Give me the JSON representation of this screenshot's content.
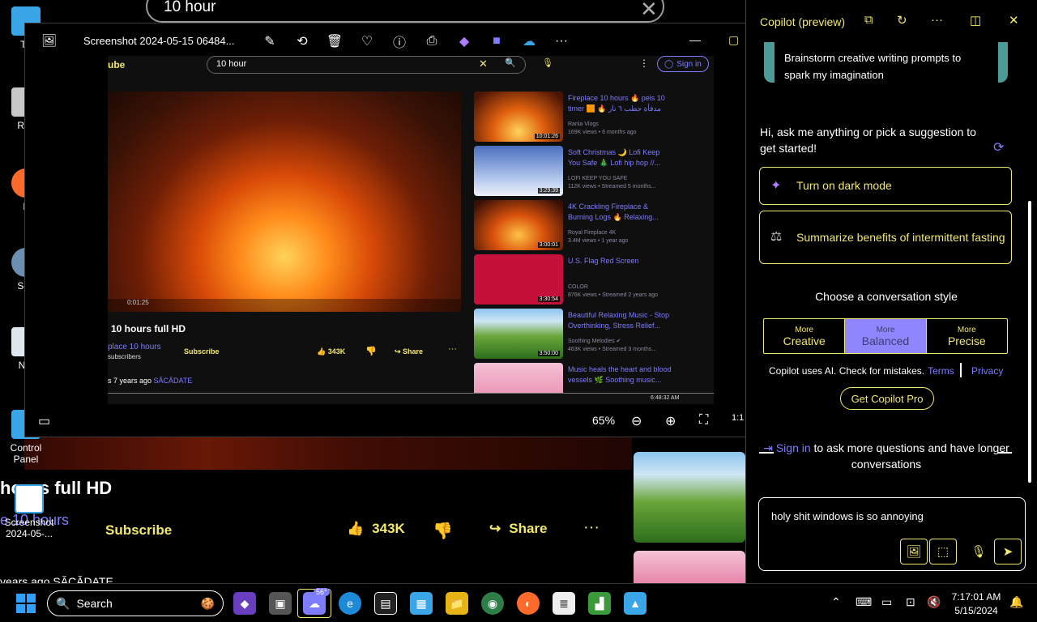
{
  "background": {
    "search_text": "10 hour",
    "video_title": "hours full HD",
    "channel": "e 10 hours",
    "subscribe": "Subscribe",
    "likes": "343K",
    "share": "Share",
    "date": "years ago SĂCĂDATE"
  },
  "desktop": {
    "icons": [
      {
        "label": "Th"
      },
      {
        "label": "Rec"
      },
      {
        "label": "F"
      },
      {
        "label": "Sup"
      },
      {
        "label": "Not"
      },
      {
        "label": "Control Panel"
      },
      {
        "label": "Screenshot 2024-05-..."
      }
    ]
  },
  "viewer": {
    "title": "Screenshot 2024-05-15 06484...",
    "zoom": "65%",
    "shot": {
      "logo": "ube",
      "search_text": "10 hour",
      "signin": "Sign in",
      "video_title": "10 hours full HD",
      "player_time": "0:01:25",
      "channel": "place 10 hours",
      "subscribers": "subscribers",
      "subscribe": "Subscribe",
      "likes": "343K",
      "share": "Share",
      "date_prefix": "s 7 years ago",
      "date_tag": "SĂCĂDATE",
      "taskbar_time": "6:48:32 AM",
      "recommendations": [
        {
          "title": "Fireplace 10 hours 🔥 peis 10 timer 🟧 🔥 مدفأة حطب ٦ نار",
          "meta": "Rania Vlogs\n169K views • 6 months ago",
          "duration": "10:01:26"
        },
        {
          "title": "Soft Christmas 🌙 Lofi Keep You Safe 🎄 Lofi hip hop //...",
          "meta": "LOFI KEEP YOU SAFE\n112K views • Streamed 5 months...",
          "duration": "3:29:39"
        },
        {
          "title": "4K Crackling Fireplace & Burning Logs 🔥 Relaxing...",
          "meta": "Royal Fireplace 4K\n3.4M views • 1 year ago",
          "duration": "3:00:01"
        },
        {
          "title": "U.S. Flag Red Screen",
          "meta": "COLOR\n876K views • Streamed 2 years ago",
          "duration": "3:30:54"
        },
        {
          "title": "Beautiful Relaxing Music - Stop Overthinking, Stress Relief...",
          "meta": "Soothing Melodies ✔\n463K views • Streamed 3 months...",
          "duration": "3:50:00"
        },
        {
          "title": "Music heals the heart and blood vessels 🌿 Soothing music...",
          "meta": "",
          "duration": ""
        }
      ]
    }
  },
  "copilot": {
    "title": "Copilot (preview)",
    "prev_suggestion": "Brainstorm creative writing prompts to spark my imagination",
    "greeting": "Hi, ask me anything or pick a suggestion to get started!",
    "suggestions": [
      {
        "label": "Turn on dark mode"
      },
      {
        "label": "Summarize benefits of intermittent fasting"
      }
    ],
    "style_label": "Choose a conversation style",
    "styles": [
      {
        "more": "More",
        "name": "Creative",
        "active": false
      },
      {
        "more": "More",
        "name": "Balanced",
        "active": true
      },
      {
        "more": "More",
        "name": "Precise",
        "active": false
      }
    ],
    "disclaimer": "Copilot uses AI. Check for mistakes.",
    "terms": "Terms",
    "privacy": "Privacy",
    "pro_button": "Get Copilot Pro",
    "signin_link": "Sign in",
    "signin_rest": "to ask more questions and have longer conversations",
    "input_value": "holy shit windows is so annoying"
  },
  "taskbar": {
    "search_label": "Search",
    "weather_badge": "56°",
    "time": "7:17:01 AM",
    "date": "5/15/2024"
  },
  "colors": {
    "accent_yellow": "#f2e86b",
    "link_purple": "#7e7cff",
    "active_style": "#8f86ff"
  }
}
